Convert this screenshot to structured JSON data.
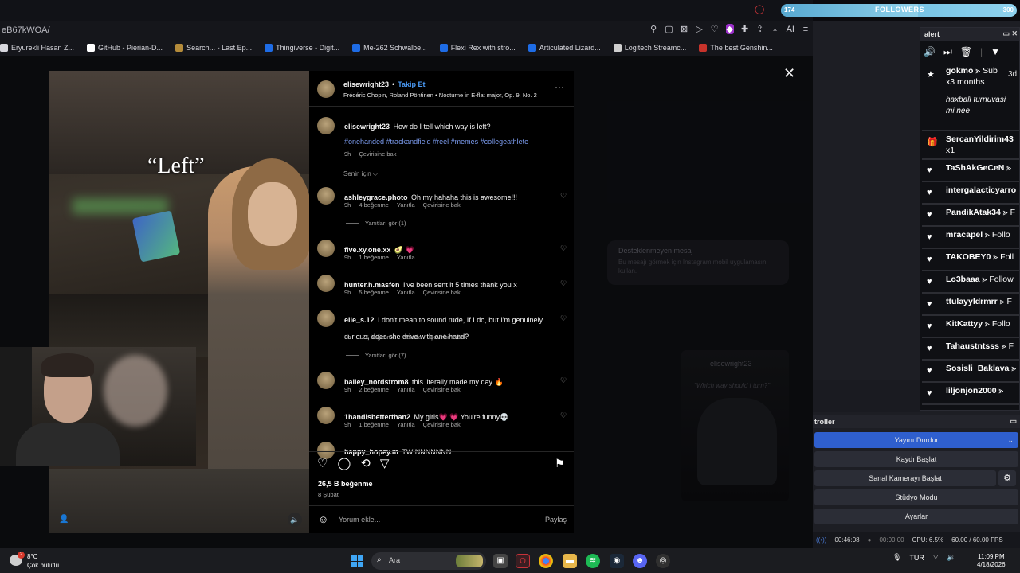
{
  "browser": {
    "url": "eB67kWOA/",
    "toolbar_icons": [
      "bookmark-icon",
      "screenshot-icon",
      "save-icon",
      "play-icon",
      "heart-icon",
      "extension-icon",
      "puzzle-icon",
      "share-icon",
      "download-icon",
      "ai-icon",
      "menu-icon"
    ],
    "ai_label": "AI",
    "bookmarks": [
      {
        "label": "Eryurekli Hasan Z...",
        "color": "#d7d7dd"
      },
      {
        "label": "GitHub - Pierian-D...",
        "color": "#ffffff"
      },
      {
        "label": "Search... - Last Ep...",
        "color": "#b48b3a"
      },
      {
        "label": "Thingiverse - Digit...",
        "color": "#1e6ce6"
      },
      {
        "label": "Me-262 Schwalbe...",
        "color": "#1e6ce6"
      },
      {
        "label": "Flexi Rex with stro...",
        "color": "#1e6ce6"
      },
      {
        "label": "Articulated Lizard...",
        "color": "#1e6ce6"
      },
      {
        "label": "Logitech Streamc...",
        "color": "#cfcfcf"
      },
      {
        "label": "The best Genshin...",
        "color": "#c7332b"
      }
    ]
  },
  "ghost": {
    "card_title": "Desteklenmeyen mesaj",
    "card_text": "Bu mesajı görmek için Instagram mobil uygulamasını kullan.",
    "video_user": "elisewright23",
    "video_quote": "\"Which way should I turn?\""
  },
  "post": {
    "caption_overlay": "“Left”",
    "author": "elisewright23",
    "follow_label": "Takip Et",
    "audio": "Frédéric Chopin, Roland Pöntinen • Nocturne in E-flat major, Op. 9, No. 2",
    "caption_user": "elisewright23",
    "caption_text": "How do I tell which way is left?",
    "hashtags": "#onehanded #trackandfield #reel #memes #collegeathlete",
    "caption_time": "9h",
    "translate_label": "Çevirisine bak",
    "sort_label": "Senin için",
    "likes": "26,5 B beğenme",
    "date": "8 Şubat",
    "comment_placeholder": "Yorum ekle...",
    "share_label": "Paylaş"
  },
  "comments": [
    {
      "user": "ashleygrace.photo",
      "text": "Oh my hahaha this is awesome!!!",
      "time": "9h",
      "likes": "4 beğenme",
      "reply": "Yanıtla",
      "translate": "Çevirisine bak",
      "replies": "Yanıtları gör (1)"
    },
    {
      "user": "five.xy.one.xx",
      "text": "🥑 💗",
      "time": "9h",
      "likes": "1 beğenme",
      "reply": "Yanıtla",
      "translate": "",
      "replies": ""
    },
    {
      "user": "hunter.h.masfen",
      "text": "I've been sent it 5 times thank you x",
      "time": "9h",
      "likes": "5 beğenme",
      "reply": "Yanıtla",
      "translate": "Çevirisine bak",
      "replies": ""
    },
    {
      "user": "elle_s.12",
      "text": "I don't mean to sound rude, If I do, but I'm genuinely curious, does she drive with one hand?",
      "time": "9h",
      "likes": "175 beğenme",
      "reply": "Yanıtla",
      "translate": "Çevirisine bak",
      "replies": "Yanıtları gör (7)"
    },
    {
      "user": "bailey_nordstrom8",
      "text": "this literally made my day 🔥",
      "time": "9h",
      "likes": "2 beğenme",
      "reply": "Yanıtla",
      "translate": "Çevirisine bak",
      "replies": ""
    },
    {
      "user": "1handisbetterthan2",
      "text": "My girls💗 💗 You're funny💀",
      "time": "9h",
      "likes": "1 beğenme",
      "reply": "Yanıtla",
      "translate": "Çevirisine bak",
      "replies": ""
    },
    {
      "user": "happy_hopey.m",
      "text": "TWINNNNNNN",
      "time": "",
      "likes": "",
      "reply": "",
      "translate": "",
      "replies": ""
    }
  ],
  "followers_bar": {
    "count": "174",
    "label": "FOLLOWERS",
    "goal": "300",
    "progress": 0.58
  },
  "alert_dock": {
    "title": "alert",
    "items": [
      {
        "icon": "star-icon",
        "name": "gokmo",
        "suffix": "⪢ Sub",
        "sub": "x3 months",
        "msg": "haxball turnuvasi mi nee",
        "ago": "3d"
      },
      {
        "icon": "gift-icon",
        "name": "SercanYildirim43",
        "suffix": "",
        "sub": "x1",
        "msg": "",
        "ago": ""
      },
      {
        "icon": "heart-icon",
        "name": "TaShAkGeCeN",
        "suffix": "⪢",
        "sub": "",
        "msg": "",
        "ago": ""
      },
      {
        "icon": "heart-icon",
        "name": "intergalacticyarro",
        "suffix": "",
        "sub": "",
        "msg": "",
        "ago": ""
      },
      {
        "icon": "heart-icon",
        "name": "PandikAtak34",
        "suffix": "⪢ F",
        "sub": "",
        "msg": "",
        "ago": ""
      },
      {
        "icon": "heart-icon",
        "name": "mracapel",
        "suffix": "⪢ Follo",
        "sub": "",
        "msg": "",
        "ago": ""
      },
      {
        "icon": "heart-icon",
        "name": "TAKOBEY0",
        "suffix": "⪢ Foll",
        "sub": "",
        "msg": "",
        "ago": ""
      },
      {
        "icon": "heart-icon",
        "name": "Lo3baaa",
        "suffix": "⪢ Follow",
        "sub": "",
        "msg": "",
        "ago": ""
      },
      {
        "icon": "heart-icon",
        "name": "ttulayyldrmrr",
        "suffix": "⪢ F",
        "sub": "",
        "msg": "",
        "ago": ""
      },
      {
        "icon": "heart-icon",
        "name": "KitKattyy",
        "suffix": "⪢ Follo",
        "sub": "",
        "msg": "",
        "ago": ""
      },
      {
        "icon": "heart-icon",
        "name": "Tahaustntsss",
        "suffix": "⪢ F",
        "sub": "",
        "msg": "",
        "ago": ""
      },
      {
        "icon": "heart-icon",
        "name": "Sosisli_Baklava",
        "suffix": "⪢",
        "sub": "",
        "msg": "",
        "ago": ""
      },
      {
        "icon": "heart-icon",
        "name": "liljonjon2000",
        "suffix": "⪢",
        "sub": "",
        "msg": "",
        "ago": ""
      }
    ]
  },
  "controls": {
    "title": "troller",
    "stop_stream": "Yayını Durdur",
    "start_record": "Kaydı Başlat",
    "virtual_cam": "Sanal Kamerayı Başlat",
    "studio_mode": "Stüdyo Modu",
    "settings": "Ayarlar"
  },
  "obs_status": {
    "live_time": "00:46:08",
    "rec_time": "00:00:00",
    "cpu": "CPU: 6.5%",
    "fps": "60.00 / 60.00 FPS"
  },
  "taskbar": {
    "temp": "8°C",
    "condition": "Çok bulutlu",
    "weather_badge": "2",
    "search_placeholder": "Ara",
    "lang": "TUR",
    "time": "11:09 PM",
    "date": "4/18/2026"
  }
}
